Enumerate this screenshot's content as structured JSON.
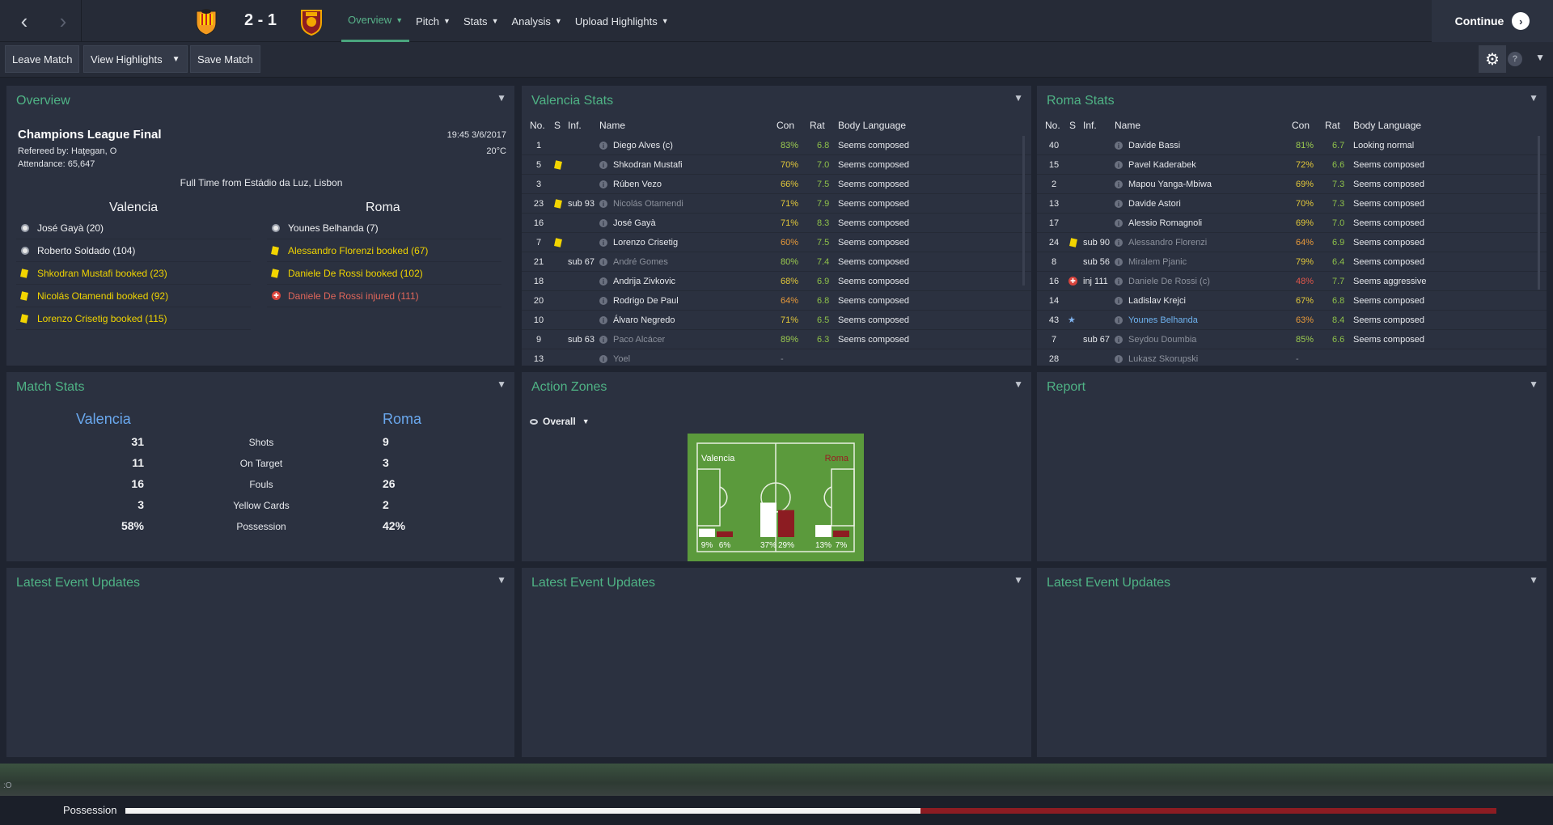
{
  "topbar": {
    "score": "2 - 1",
    "nav": [
      {
        "label": "Overview",
        "active": true
      },
      {
        "label": "Pitch",
        "active": false
      },
      {
        "label": "Stats",
        "active": false
      },
      {
        "label": "Analysis",
        "active": false
      },
      {
        "label": "Upload Highlights",
        "active": false
      }
    ],
    "continue_label": "Continue"
  },
  "toolbar": {
    "leave_match": "Leave Match",
    "view_highlights": "View Highlights",
    "save_match": "Save Match"
  },
  "overview": {
    "title": "Overview",
    "competition": "Champions League Final",
    "datetime": "19:45 3/6/2017",
    "temperature": "20°C",
    "referee": "Refereed by: Haţegan, O",
    "attendance": "Attendance: 65,647",
    "venue": "Full Time from Estádio da Luz, Lisbon",
    "home_team": "Valencia",
    "away_team": "Roma",
    "home_events": [
      {
        "type": "goal",
        "text": "José Gayà (20)"
      },
      {
        "type": "goal",
        "text": "Roberto Soldado (104)"
      },
      {
        "type": "booking",
        "text": "Shkodran Mustafi booked (23)"
      },
      {
        "type": "booking",
        "text": "Nicolás Otamendi booked (92)"
      },
      {
        "type": "booking",
        "text": "Lorenzo Crisetig booked (115)"
      }
    ],
    "away_events": [
      {
        "type": "goal",
        "text": "Younes Belhanda (7)"
      },
      {
        "type": "booking",
        "text": "Alessandro Florenzi booked (67)"
      },
      {
        "type": "booking",
        "text": "Daniele De Rossi booked (102)"
      },
      {
        "type": "injury",
        "text": "Daniele De Rossi injured (111)"
      }
    ]
  },
  "valencia_stats": {
    "title": "Valencia Stats",
    "headers": {
      "no": "No.",
      "s": "S",
      "inf": "Inf.",
      "name": "Name",
      "con": "Con",
      "rat": "Rat",
      "body": "Body Language"
    },
    "rows": [
      {
        "no": "1",
        "card": false,
        "inf": "",
        "name": "Diego Alves (c)",
        "con": "83%",
        "rat": "6.8",
        "body": "Seems composed",
        "dim": false
      },
      {
        "no": "5",
        "card": true,
        "inf": "",
        "name": "Shkodran Mustafi",
        "con": "70%",
        "rat": "7.0",
        "body": "Seems composed",
        "dim": false
      },
      {
        "no": "3",
        "card": false,
        "inf": "",
        "name": "Rúben Vezo",
        "con": "66%",
        "rat": "7.5",
        "body": "Seems composed",
        "dim": false
      },
      {
        "no": "23",
        "card": true,
        "inf": "sub 93",
        "name": "Nicolás Otamendi",
        "con": "71%",
        "rat": "7.9",
        "body": "Seems composed",
        "dim": true
      },
      {
        "no": "16",
        "card": false,
        "inf": "",
        "name": "José Gayà",
        "con": "71%",
        "rat": "8.3",
        "body": "Seems composed",
        "dim": false
      },
      {
        "no": "7",
        "card": true,
        "inf": "",
        "name": "Lorenzo Crisetig",
        "con": "60%",
        "rat": "7.5",
        "body": "Seems composed",
        "dim": false
      },
      {
        "no": "21",
        "card": false,
        "inf": "sub 67",
        "name": "André Gomes",
        "con": "80%",
        "rat": "7.4",
        "body": "Seems composed",
        "dim": true
      },
      {
        "no": "18",
        "card": false,
        "inf": "",
        "name": "Andrija Zivkovic",
        "con": "68%",
        "rat": "6.9",
        "body": "Seems composed",
        "dim": false
      },
      {
        "no": "20",
        "card": false,
        "inf": "",
        "name": "Rodrigo De Paul",
        "con": "64%",
        "rat": "6.8",
        "body": "Seems composed",
        "dim": false
      },
      {
        "no": "10",
        "card": false,
        "inf": "",
        "name": "Álvaro Negredo",
        "con": "71%",
        "rat": "6.5",
        "body": "Seems composed",
        "dim": false
      },
      {
        "no": "9",
        "card": false,
        "inf": "sub 63",
        "name": "Paco Alcácer",
        "con": "89%",
        "rat": "6.3",
        "body": "Seems composed",
        "dim": true
      },
      {
        "no": "13",
        "card": false,
        "inf": "",
        "name": "Yoel",
        "con": "-",
        "rat": "",
        "body": "",
        "dim": true
      }
    ]
  },
  "roma_stats": {
    "title": "Roma Stats",
    "headers": {
      "no": "No.",
      "s": "S",
      "inf": "Inf.",
      "name": "Name",
      "con": "Con",
      "rat": "Rat",
      "body": "Body Language"
    },
    "rows": [
      {
        "no": "40",
        "mark": "",
        "inf": "",
        "name": "Davide Bassi",
        "con": "81%",
        "rat": "6.7",
        "body": "Looking normal",
        "dim": false
      },
      {
        "no": "15",
        "mark": "",
        "inf": "",
        "name": "Pavel Kaderabek",
        "con": "72%",
        "rat": "6.6",
        "body": "Seems composed",
        "dim": false
      },
      {
        "no": "2",
        "mark": "",
        "inf": "",
        "name": "Mapou Yanga-Mbiwa",
        "con": "69%",
        "rat": "7.3",
        "body": "Seems composed",
        "dim": false
      },
      {
        "no": "13",
        "mark": "",
        "inf": "",
        "name": "Davide Astori",
        "con": "70%",
        "rat": "7.3",
        "body": "Seems composed",
        "dim": false
      },
      {
        "no": "17",
        "mark": "",
        "inf": "",
        "name": "Alessio Romagnoli",
        "con": "69%",
        "rat": "7.0",
        "body": "Seems composed",
        "dim": false
      },
      {
        "no": "24",
        "mark": "card",
        "inf": "sub 90",
        "name": "Alessandro Florenzi",
        "con": "64%",
        "rat": "6.9",
        "body": "Seems composed",
        "dim": true
      },
      {
        "no": "8",
        "mark": "",
        "inf": "sub 56",
        "name": "Miralem Pjanic",
        "con": "79%",
        "rat": "6.4",
        "body": "Seems composed",
        "dim": true
      },
      {
        "no": "16",
        "mark": "injury",
        "inf": "inj 111",
        "name": "Daniele De Rossi (c)",
        "con": "48%",
        "rat": "7.7",
        "body": "Seems aggressive",
        "dim": true
      },
      {
        "no": "14",
        "mark": "",
        "inf": "",
        "name": "Ladislav Krejci",
        "con": "67%",
        "rat": "6.8",
        "body": "Seems composed",
        "dim": false
      },
      {
        "no": "43",
        "mark": "star",
        "inf": "",
        "name": "Younes Belhanda",
        "con": "63%",
        "rat": "8.4",
        "body": "Seems composed",
        "dim": false
      },
      {
        "no": "7",
        "mark": "",
        "inf": "sub 67",
        "name": "Seydou Doumbia",
        "con": "85%",
        "rat": "6.6",
        "body": "Seems composed",
        "dim": true
      },
      {
        "no": "28",
        "mark": "",
        "inf": "",
        "name": "Lukasz Skorupski",
        "con": "-",
        "rat": "",
        "body": "",
        "dim": true
      }
    ]
  },
  "match_stats": {
    "title": "Match Stats",
    "home": "Valencia",
    "away": "Roma",
    "rows": [
      {
        "label": "Shots",
        "home": "31",
        "away": "9"
      },
      {
        "label": "On Target",
        "home": "11",
        "away": "3"
      },
      {
        "label": "Fouls",
        "home": "16",
        "away": "26"
      },
      {
        "label": "Yellow Cards",
        "home": "3",
        "away": "2"
      },
      {
        "label": "Possession",
        "home": "58%",
        "away": "42%"
      }
    ]
  },
  "action_zones": {
    "title": "Action Zones",
    "filter": "Overall",
    "home_label": "Valencia",
    "away_label": "Roma",
    "zones": [
      {
        "home": 9,
        "away": 6,
        "home_label": "9%",
        "away_label": "6%"
      },
      {
        "home": 37,
        "away": 29,
        "home_label": "37%",
        "away_label": "29%"
      },
      {
        "home": 13,
        "away": 7,
        "home_label": "13%",
        "away_label": "7%"
      }
    ]
  },
  "report": {
    "title": "Report"
  },
  "latest": {
    "title": "Latest Event Updates"
  },
  "status": {
    "cursor_text": ":O"
  },
  "possession": {
    "label": "Possession",
    "home_share": 0.58
  },
  "colors": {
    "accent": "#4fb385",
    "home": "#ffffff",
    "away": "#8c1c22",
    "booking": "#f0d400"
  }
}
